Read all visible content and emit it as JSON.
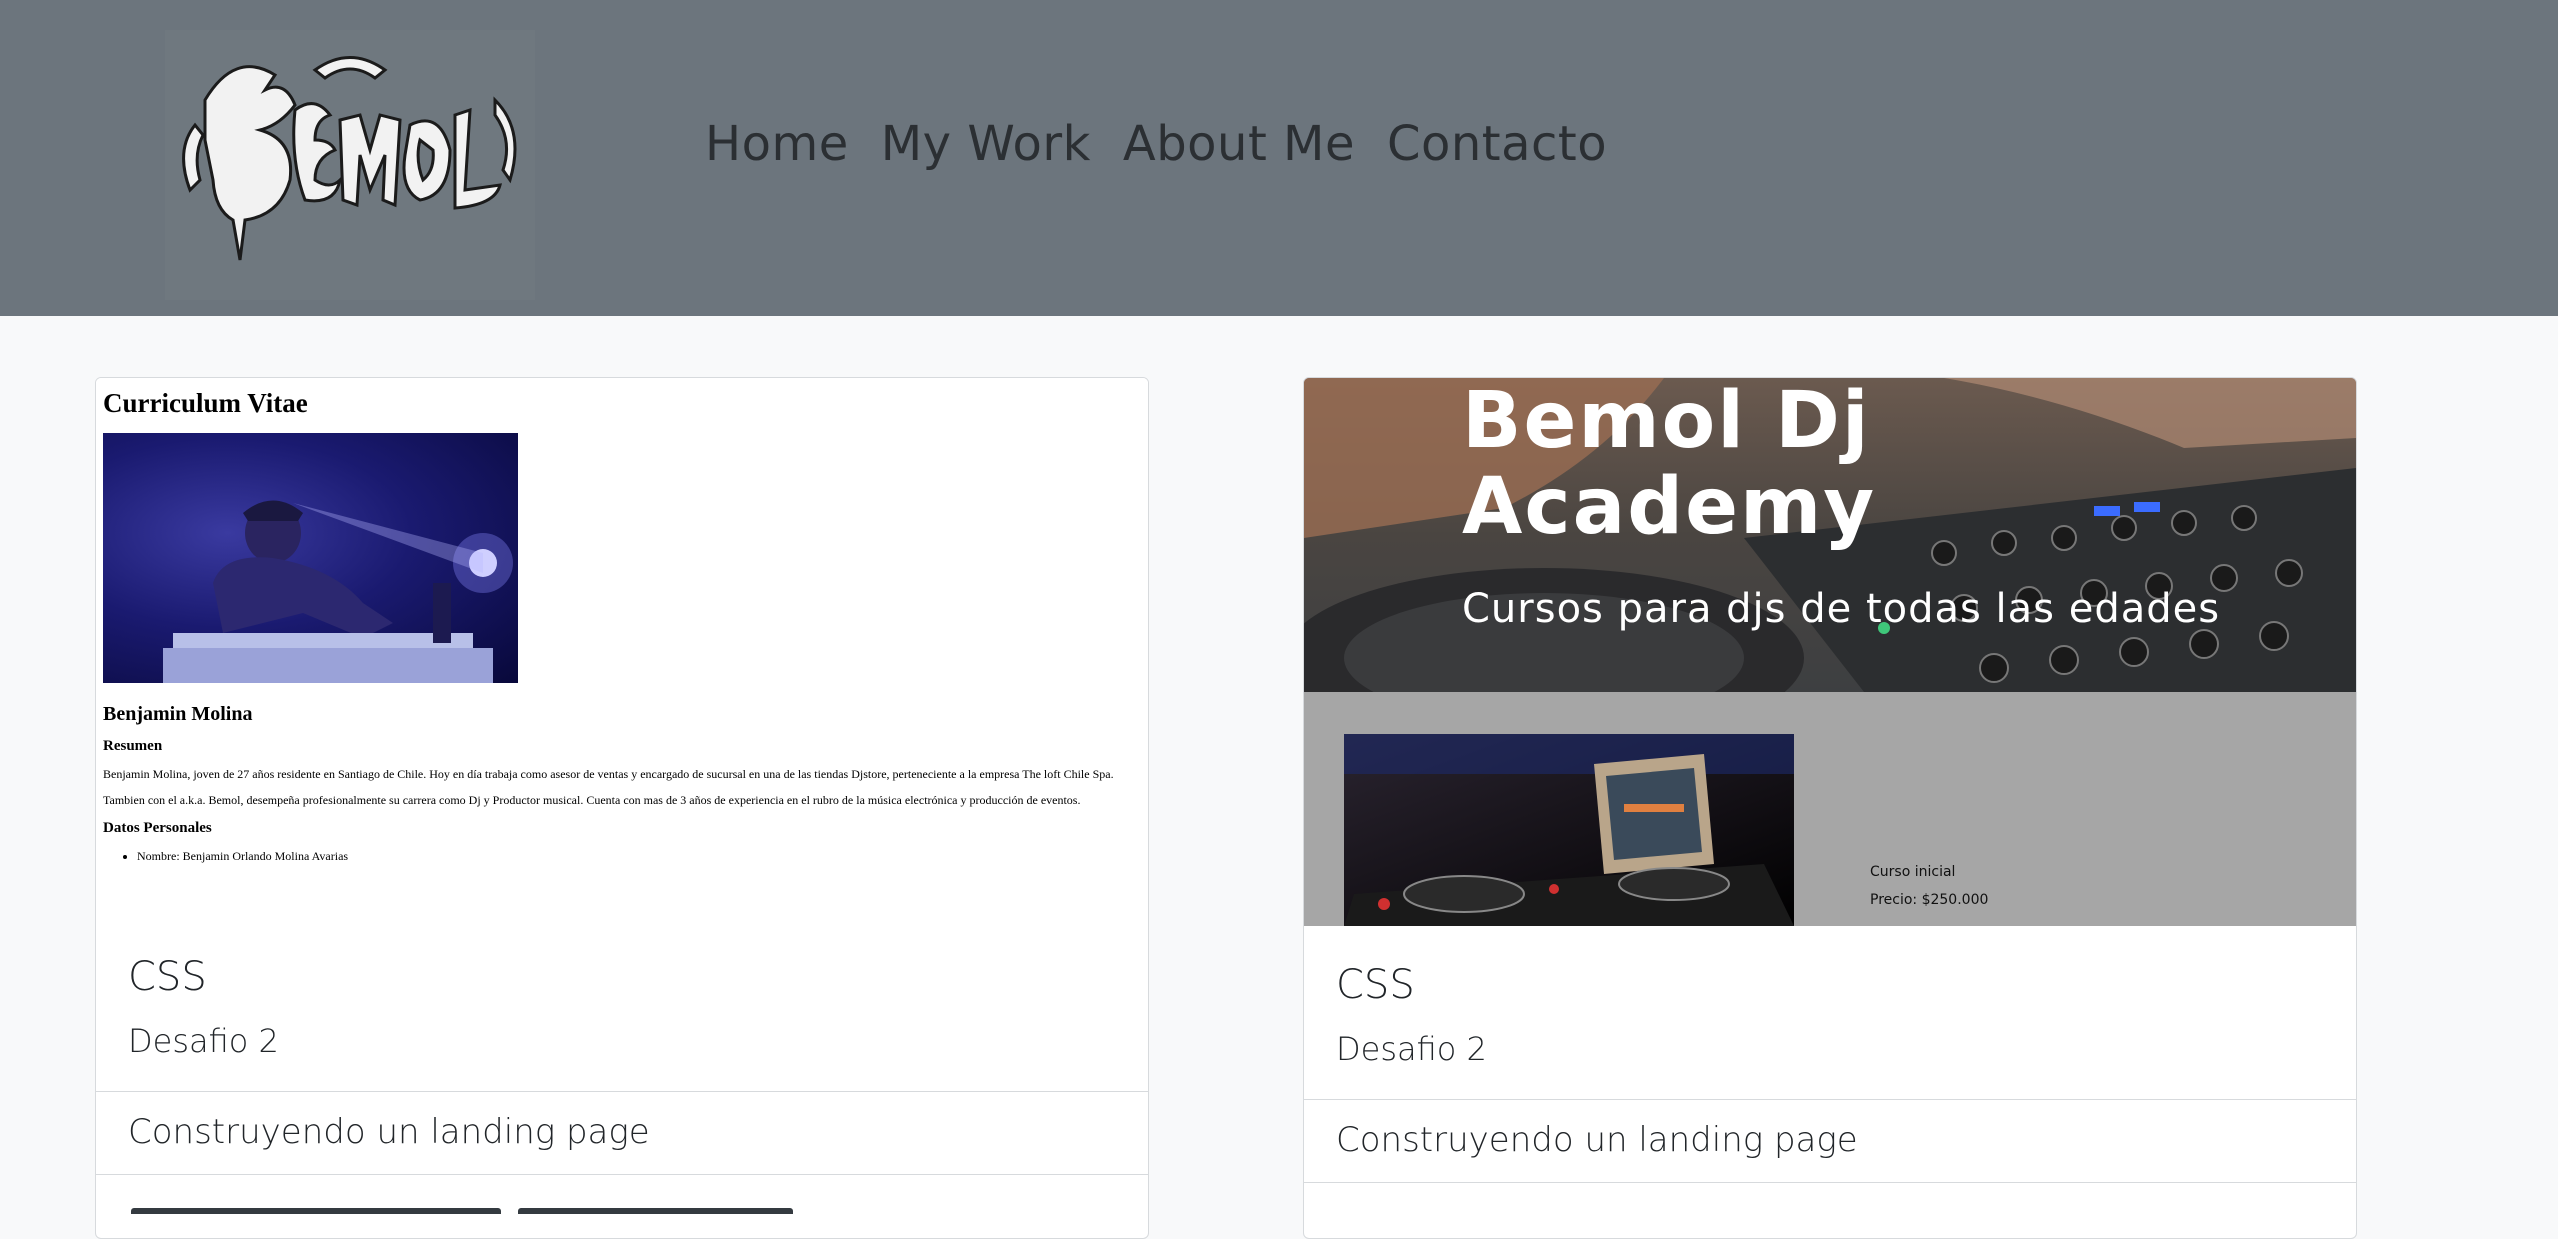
{
  "nav": {
    "logo_text": "Bemol",
    "links": [
      "Home",
      "My Work",
      "About Me",
      "Contacto"
    ]
  },
  "cards": [
    {
      "preview": {
        "heading": "Curriculum Vitae",
        "name": "Benjamin Molina",
        "summary_heading": "Resumen",
        "summary_p1": "Benjamin Molina, joven de 27 años residente en Santiago de Chile. Hoy en día trabaja como asesor de ventas y encargado de sucursal en una de las tiendas Djstore, perteneciente a la empresa The loft Chile Spa.",
        "summary_p2": "Tambien con el a.k.a. Bemol, desempeña profesionalmente su carrera como Dj y Productor musical. Cuenta con mas de 3 años de experiencia en el rubro de la música electrónica y producción de eventos.",
        "personal_heading": "Datos Personales",
        "personal_items": [
          "Nombre: Benjamin Orlando Molina Avarias"
        ]
      },
      "title": "CSS",
      "text": "Desafio 2",
      "list_item": "Construyendo un landing page"
    },
    {
      "preview": {
        "hero_title": "Bemol Dj Academy",
        "hero_subtitle": "Cursos para djs de todas las edades",
        "course_name": "Curso inicial",
        "course_price": "Precio: $250.000"
      },
      "title": "CSS",
      "text": "Desafio 2",
      "list_item": "Construyendo un landing page"
    }
  ]
}
